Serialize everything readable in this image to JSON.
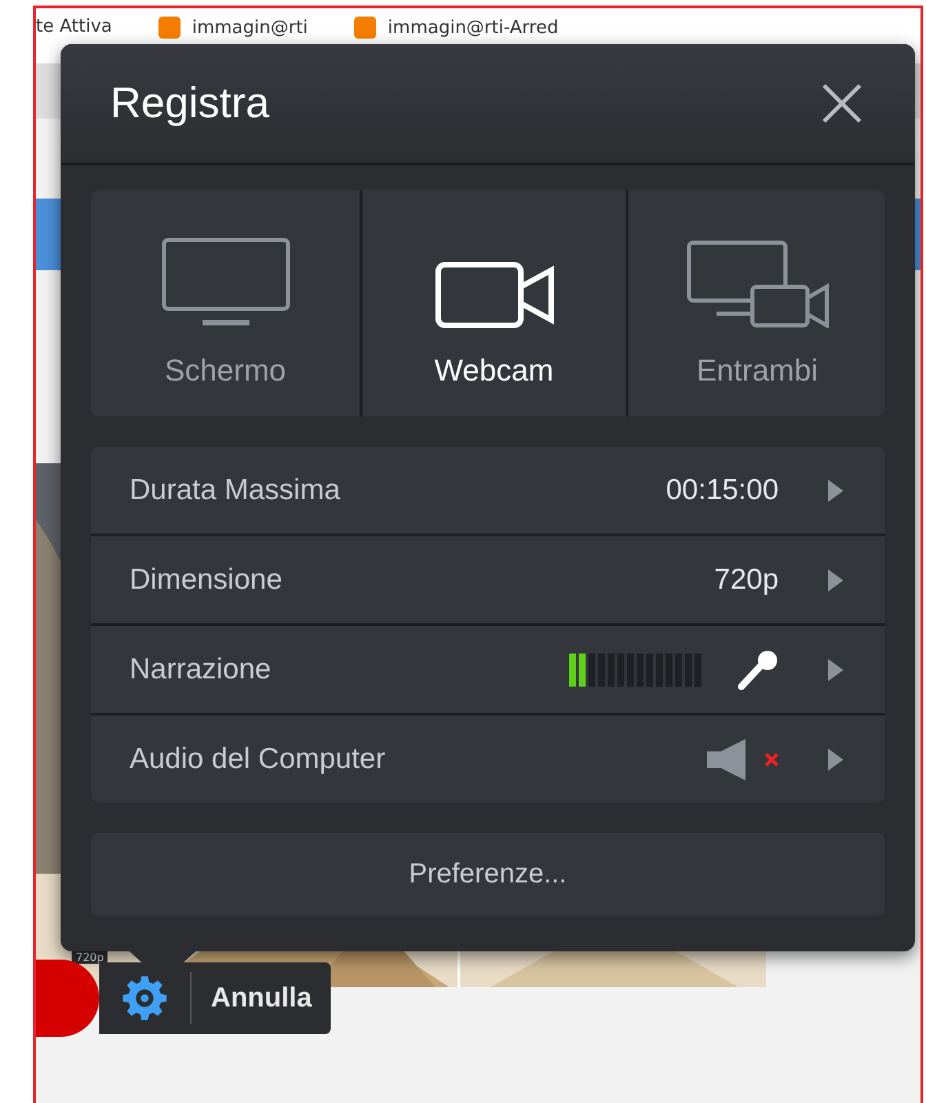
{
  "background": {
    "bookmarks": [
      "te Attiva",
      "immagin@rti",
      "immagin@rti-Arred"
    ],
    "preview_label": "720p"
  },
  "dialog": {
    "title": "Registra",
    "modes": [
      {
        "kind": "screen",
        "label": "Schermo",
        "selected": false
      },
      {
        "kind": "webcam",
        "label": "Webcam",
        "selected": true
      },
      {
        "kind": "both",
        "label": "Entrambi",
        "selected": false
      }
    ],
    "settings": [
      {
        "kind": "value",
        "label": "Durata Massima",
        "value": "00:15:00"
      },
      {
        "kind": "value",
        "label": "Dimensione",
        "value": "720p"
      },
      {
        "kind": "meter",
        "label": "Narrazione",
        "level": 0.14
      },
      {
        "kind": "audio",
        "label": "Audio del Computer",
        "muted": true
      }
    ],
    "preferences_button": "Preferenze..."
  },
  "toolbar": {
    "cancel_button": "Annulla"
  }
}
